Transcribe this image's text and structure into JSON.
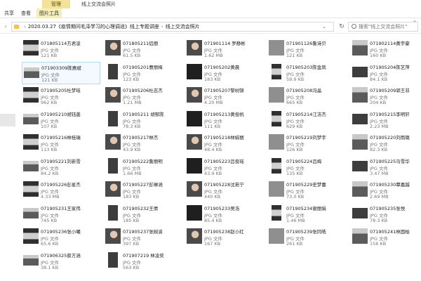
{
  "window": {
    "context_tab": "管理",
    "title": "线上交流会照片"
  },
  "ribbon": {
    "tabs": [
      "共享",
      "查看",
      "图片工具"
    ],
    "active_index": 2,
    "expand": "⌄"
  },
  "address": {
    "crumbs": [
      "2020.03.27《疫情期间毛泽学习的心理调适》线上专题讲座",
      "线上交流会照片"
    ],
    "dropdown": "⌄"
  },
  "search": {
    "placeholder": "搜索\"线上交流会照片\""
  },
  "files": [
    {
      "name": "071805114方君凌",
      "type": "JPG 文件",
      "size": "121 KB"
    },
    {
      "name": "071805211侣丽",
      "type": "JPG 文件",
      "size": "61.5 KB"
    },
    {
      "name": "071901114 罗静彬",
      "type": "JPG 文件",
      "size": "1.62 MB"
    },
    {
      "name": "071901126鲁诗贝",
      "type": "JPG 文件",
      "size": "121 KB"
    },
    {
      "name": "071902114黄宇豪",
      "type": "JPG 文件",
      "size": "160 KB"
    },
    {
      "name": "071903309陈惠斌",
      "type": "JPG 文件",
      "size": "121 KB"
    },
    {
      "name": "071905201曹丽梅",
      "type": "JPG 文件",
      "size": "123 KB"
    },
    {
      "name": "071905202黄晨",
      "type": "JPG 文件",
      "size": "183 KB"
    },
    {
      "name": "071905203陈金凤",
      "type": "JPG 文件",
      "size": "59.9 KB"
    },
    {
      "name": "071905204陈艺萍",
      "type": "JPG 文件",
      "size": "84.1 KB"
    },
    {
      "name": "071905205杜梦瑶",
      "type": "JPG 文件",
      "size": "962 KB"
    },
    {
      "name": "071905206杜志杰",
      "type": "JPG 文件",
      "size": "1.21 MB"
    },
    {
      "name": "071905207黎树锦",
      "type": "JPG 文件",
      "size": "4.20 MB"
    },
    {
      "name": "071905208冯晶",
      "type": "JPG 文件",
      "size": "665 KB"
    },
    {
      "name": "071905209郭王非",
      "type": "JPG 文件",
      "size": "204 KB"
    },
    {
      "name": "071905210胡钰菡",
      "type": "JPG 文件",
      "size": "107 KB"
    },
    {
      "name": "071905211 胡郁陈",
      "type": "JPG 文件",
      "size": "78.3 KB"
    },
    {
      "name": "071905213黄俊帆",
      "type": "JPG 文件",
      "size": "111 KB"
    },
    {
      "name": "071905214江洁杰",
      "type": "JPG 文件",
      "size": "629 KB"
    },
    {
      "name": "071905215李明轩",
      "type": "JPG 文件",
      "size": "2.23 MB"
    },
    {
      "name": "071905216林桂瑞",
      "type": "JPG 文件",
      "size": "113 KB"
    },
    {
      "name": "071905217林杰",
      "type": "JPG 文件",
      "size": "43.9 KB"
    },
    {
      "name": "071905218林娟丽",
      "type": "JPG 文件",
      "size": "48.4 KB"
    },
    {
      "name": "071905219刘梦宇",
      "type": "JPG 文件",
      "size": "126 KB"
    },
    {
      "name": "071905220刘雨璐",
      "type": "JPG 文件",
      "size": "82.3 KB"
    },
    {
      "name": "071905221刘新雪",
      "type": "JPG 文件",
      "size": "84.2 KB"
    },
    {
      "name": "071905222鲁丽明",
      "type": "JPG 文件",
      "size": "1.66 MB"
    },
    {
      "name": "071905223吕俊瑶",
      "type": "JPG 文件",
      "size": "43.9 KB"
    },
    {
      "name": "071905224吕梅",
      "type": "JPG 文件",
      "size": "135 KB"
    },
    {
      "name": "071905225马雪华",
      "type": "JPG 文件",
      "size": "3.47 MB"
    },
    {
      "name": "071905226彭星杰",
      "type": "JPG 文件",
      "size": "4.33 MB"
    },
    {
      "name": "071905227彭琳涵",
      "type": "JPG 文件",
      "size": "183 KB"
    },
    {
      "name": "071905228沈若宁",
      "type": "JPG 文件",
      "size": "440 KB"
    },
    {
      "name": "071905229史梦蕾",
      "type": "JPG 文件",
      "size": "73.0 KB"
    },
    {
      "name": "071905230覃嘉越",
      "type": "JPG 文件",
      "size": "2.69 MB"
    },
    {
      "name": "071905231王家伟",
      "type": "JPG 文件",
      "size": "745 KB"
    },
    {
      "name": "071905232王倩",
      "type": "JPG 文件",
      "size": "185 KB"
    },
    {
      "name": "071905233吴浩",
      "type": "JPG 文件",
      "size": "85.4 KB"
    },
    {
      "name": "071905234谢丽娟",
      "type": "JPG 文件",
      "size": "1.46 MB"
    },
    {
      "name": "071905235张悦",
      "type": "JPG 文件",
      "size": "78.3 KB"
    },
    {
      "name": "071905236张小曦",
      "type": "JPG 文件",
      "size": "65.6 KB"
    },
    {
      "name": "071905237张婉渝",
      "type": "JPG 文件",
      "size": "397 KB"
    },
    {
      "name": "071905238赵小红",
      "type": "JPG 文件",
      "size": "167 KB"
    },
    {
      "name": "071905239张同皓",
      "type": "JPG 文件",
      "size": "261 KB"
    },
    {
      "name": "071905241林国柏",
      "type": "JPG 文件",
      "size": "156 KB"
    },
    {
      "name": "071906325蔡方涵",
      "type": "JPG 文件",
      "size": "38.1 KB"
    },
    {
      "name": "071907219 林凌奕",
      "type": "JPG 文件",
      "size": "563 KB"
    }
  ]
}
